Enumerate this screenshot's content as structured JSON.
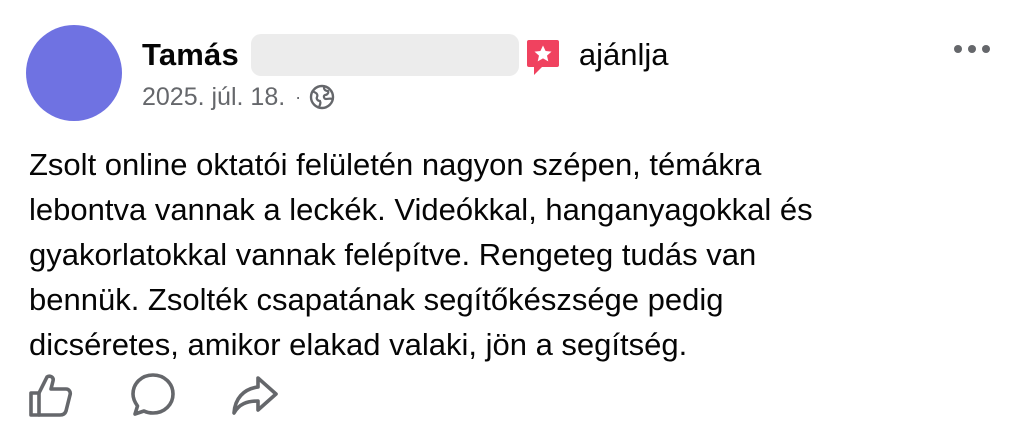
{
  "post": {
    "author": "Tamás",
    "action_text": "ajánlja",
    "date": "2025. júl. 18.",
    "separator": "·",
    "audience_icon": "globe-icon",
    "more_icon": "more-options-icon",
    "body": "Zsolt online oktatói felületén nagyon szépen, témákra\nlebontva vannak a leckék. Videókkal, hanganyagokkal és\ngyakorlatokkal vannak felépítve. Rengeteg tudás van\nbennük. Zsolték csapatának segítőkészsége pedig\ndicséretes, amikor elakad valaki, jön a segítség."
  },
  "actions": [
    {
      "icon": "thumbs-up-icon"
    },
    {
      "icon": "comment-icon"
    },
    {
      "icon": "share-icon"
    }
  ],
  "colors": {
    "avatar": "#6f72e2",
    "recommend_badge": "#f0425f",
    "meta_text": "#65676b",
    "redaction": "#ececec"
  }
}
